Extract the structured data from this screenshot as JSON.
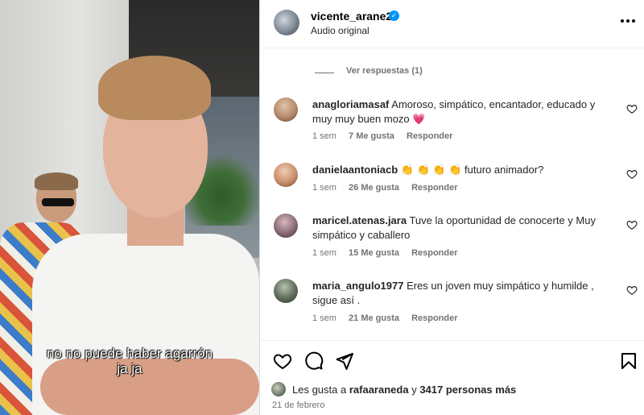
{
  "video": {
    "subtitle_line1": "no no puede haber agarrón",
    "subtitle_line2": "ja ja"
  },
  "header": {
    "username": "vicente_arane2",
    "verified": true,
    "audio": "Audio original",
    "more_icon": "more-horizontal-icon"
  },
  "replies_toggle": "Ver respuestas (1)",
  "comments": [
    {
      "username": "anagloriamasaf",
      "text": "Amoroso, simpático, encantador, educado y muy muy buen mozo 💗",
      "time": "1 sem",
      "likes": "7 Me gusta",
      "reply": "Responder",
      "avatar_color": "#b58a6a"
    },
    {
      "username": "danielaantoniacb",
      "text": "👏 👏 👏 👏  futuro animador?",
      "time": "1 sem",
      "likes": "26 Me gusta",
      "reply": "Responder",
      "avatar_color": "#c98f6c"
    },
    {
      "username": "maricel.atenas.jara",
      "text": "Tuve la oportunidad de conocerte y Muy simpático y caballero",
      "time": "1 sem",
      "likes": "15 Me gusta",
      "reply": "Responder",
      "avatar_color": "#8a6a74"
    },
    {
      "username": "maria_angulo1977",
      "text": "Eres un joven muy simpático y humilde , sigue así .",
      "time": "1 sem",
      "likes": "21 Me gusta",
      "reply": "Responder",
      "avatar_color": "#5e6b58"
    }
  ],
  "likes": {
    "prefix": "Les gusta a",
    "user": "rafaaraneda",
    "middle": "y",
    "others": "3417 personas más"
  },
  "date": "21 de febrero",
  "colors": {
    "text": "#262626",
    "secondary": "#737373",
    "verified": "#0095f6",
    "heart_emoji": "#ff3b6b"
  }
}
